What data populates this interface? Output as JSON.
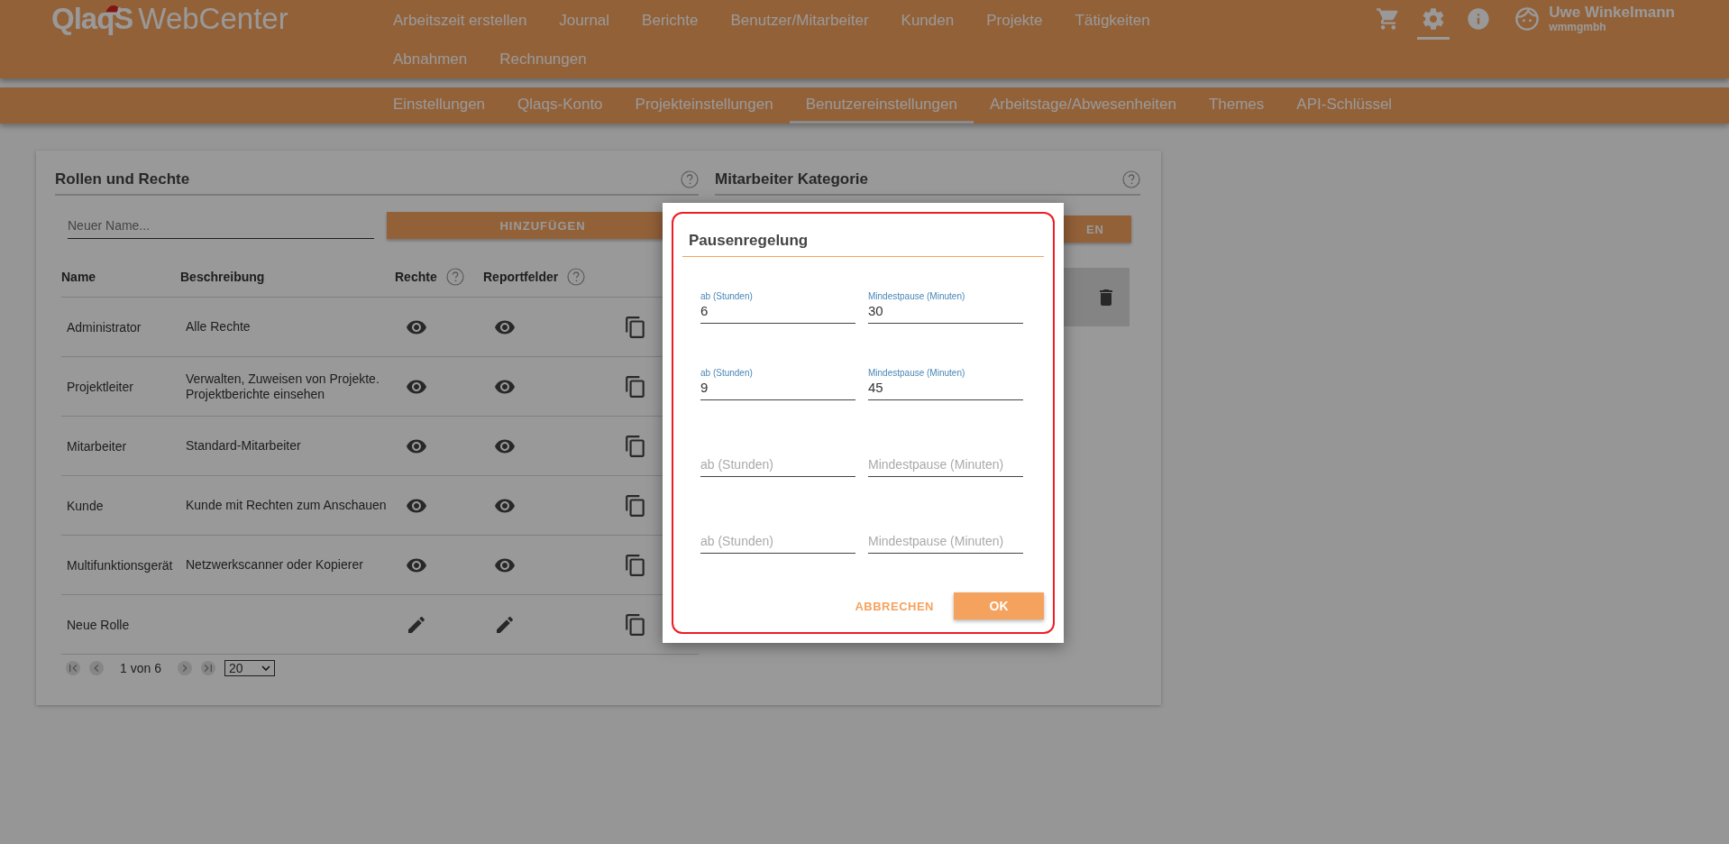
{
  "header": {
    "logo": {
      "brand": "QlaqS",
      "product": "WebCenter"
    },
    "nav": [
      {
        "label": "Arbeitszeit erstellen",
        "selected": false
      },
      {
        "label": "Journal",
        "selected": false
      },
      {
        "label": "Berichte",
        "selected": false
      },
      {
        "label": "Benutzer/Mitarbeiter",
        "selected": false
      },
      {
        "label": "Kunden",
        "selected": false
      },
      {
        "label": "Projekte",
        "selected": false
      },
      {
        "label": "Tätigkeiten",
        "selected": false
      },
      {
        "label": "Abnahmen",
        "selected": false
      },
      {
        "label": "Rechnungen",
        "selected": false
      }
    ],
    "icons": [
      {
        "kind": "cart",
        "selected": false
      },
      {
        "kind": "settings",
        "selected": true
      },
      {
        "kind": "info",
        "selected": false
      }
    ],
    "user": {
      "name": "Uwe Winkelmann",
      "company": "wmmgmbh"
    }
  },
  "tabs": [
    {
      "label": "Einstellungen",
      "selected": false
    },
    {
      "label": "Qlaqs-Konto",
      "selected": false
    },
    {
      "label": "Projekteinstellungen",
      "selected": false
    },
    {
      "label": "Benutzereinstellungen",
      "selected": true
    },
    {
      "label": "Arbeitstage/Abwesenheiten",
      "selected": false
    },
    {
      "label": "Themes",
      "selected": false
    },
    {
      "label": "API-Schlüssel",
      "selected": false
    }
  ],
  "roles": {
    "title": "Rollen und Rechte",
    "name_field": {
      "placeholder": "Neuer Name..."
    },
    "add_button": "HINZUFÜGEN",
    "columns": [
      {
        "label": "Name",
        "help": false
      },
      {
        "label": "Beschreibung",
        "help": false
      },
      {
        "label": "Rechte",
        "help": true
      },
      {
        "label": "Reportfelder",
        "help": true
      }
    ],
    "rows": [
      {
        "name": "Administrator",
        "description": "Alle Rechte",
        "kind": "view"
      },
      {
        "name": "Projektleiter",
        "description": "Verwalten, Zuweisen von Projekte. Projektberichte einsehen",
        "kind": "view"
      },
      {
        "name": "Mitarbeiter",
        "description": "Standard-Mitarbeiter",
        "kind": "view"
      },
      {
        "name": "Kunde",
        "description": "Kunde mit Rechten zum Anschauen",
        "kind": "view"
      },
      {
        "name": "Multifunktionsgerät",
        "description": "Netzwerkscanner oder Kopierer",
        "kind": "view"
      },
      {
        "name": "Neue Rolle",
        "kind": "edit"
      }
    ],
    "pagination": {
      "page": "1 von 6",
      "page_size": "20"
    }
  },
  "category": {
    "title": "Mitarbeiter Kategorie",
    "add_button": "EN"
  },
  "dialog": {
    "title": "Pausenregelung",
    "rows": [
      {
        "from": {
          "label": "ab (Stunden)",
          "value": "6"
        },
        "pause": {
          "label": "Mindestpause (Minuten)",
          "value": "30"
        }
      },
      {
        "from": {
          "label": "ab (Stunden)",
          "value": "9"
        },
        "pause": {
          "label": "Mindestpause (Minuten)",
          "value": "45"
        }
      },
      {
        "from": {
          "placeholder": "ab (Stunden)"
        },
        "pause": {
          "placeholder": "Mindestpause (Minuten)"
        }
      },
      {
        "from": {
          "placeholder": "ab (Stunden)"
        },
        "pause": {
          "placeholder": "Mindestpause (Minuten)"
        }
      }
    ],
    "cancel_button": "ABBRECHEN",
    "ok_button": "OK"
  }
}
